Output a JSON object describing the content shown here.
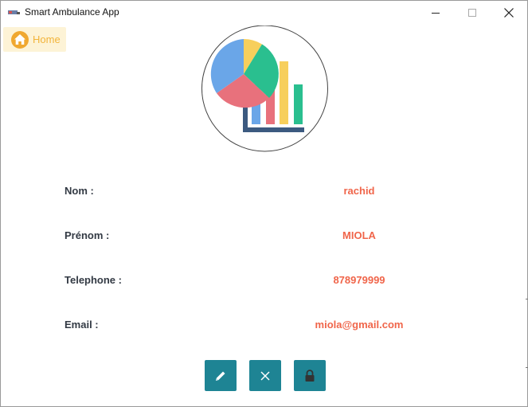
{
  "window": {
    "title": "Smart Ambulance App"
  },
  "nav": {
    "home_label": "Home",
    "home_icon": "home-icon"
  },
  "profile": {
    "fields": [
      {
        "label": "Nom :",
        "value": "rachid"
      },
      {
        "label": "Prénom :",
        "value": "MIOLA"
      },
      {
        "label": "Telephone :",
        "value": "878979999"
      },
      {
        "label": "Email :",
        "value": "miola@gmail.com"
      }
    ]
  },
  "actions": [
    {
      "name": "edit",
      "icon": "pencil-icon"
    },
    {
      "name": "close",
      "icon": "close-icon"
    },
    {
      "name": "lock",
      "icon": "lock-icon"
    }
  ],
  "colors": {
    "accent_teal": "#1e8494",
    "value_text": "#f0654a",
    "label_text": "#333a44",
    "home_bg": "#fdf3d6",
    "home_text": "#f2b43a"
  }
}
